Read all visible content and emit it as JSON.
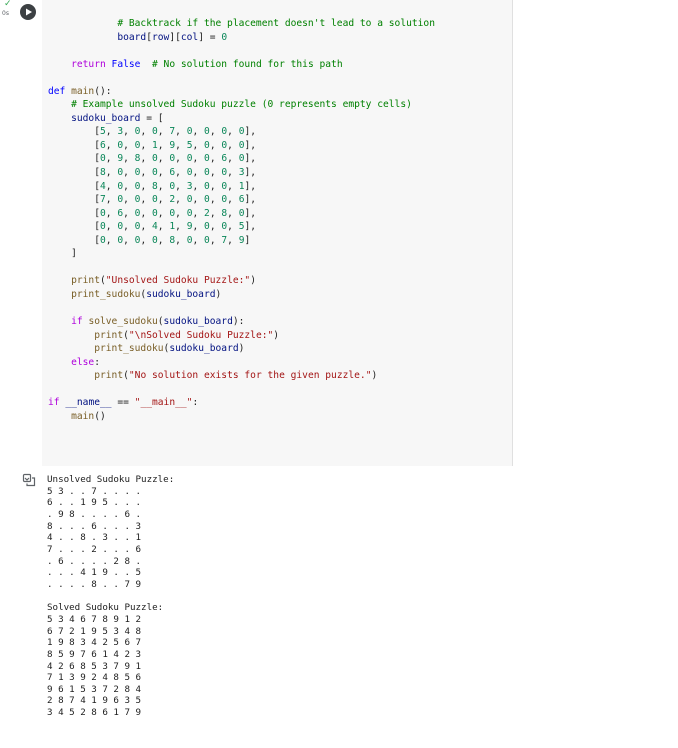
{
  "cell": {
    "status_check": "✓",
    "exec_time": "0s",
    "run_button_label": "Run cell"
  },
  "code_lines": [
    {
      "segments": [
        {
          "t": "            ",
          "c": "ink"
        },
        {
          "t": "# Backtrack if the placement doesn't lead to a solution",
          "c": "cm"
        }
      ]
    },
    {
      "segments": [
        {
          "t": "            ",
          "c": "ink"
        },
        {
          "t": "board",
          "c": "var"
        },
        {
          "t": "[",
          "c": "ink"
        },
        {
          "t": "row",
          "c": "var"
        },
        {
          "t": "][",
          "c": "ink"
        },
        {
          "t": "col",
          "c": "var"
        },
        {
          "t": "] = ",
          "c": "ink"
        },
        {
          "t": "0",
          "c": "nm"
        }
      ]
    },
    {
      "segments": []
    },
    {
      "segments": [
        {
          "t": "    ",
          "c": "ink"
        },
        {
          "t": "return",
          "c": "kw2"
        },
        {
          "t": " ",
          "c": "ink"
        },
        {
          "t": "False",
          "c": "fal"
        },
        {
          "t": "  ",
          "c": "ink"
        },
        {
          "t": "# No solution found for this path",
          "c": "cm"
        }
      ]
    },
    {
      "segments": []
    },
    {
      "segments": [
        {
          "t": "def",
          "c": "kw"
        },
        {
          "t": " ",
          "c": "ink"
        },
        {
          "t": "main",
          "c": "fn"
        },
        {
          "t": "():",
          "c": "ink"
        }
      ]
    },
    {
      "segments": [
        {
          "t": "    ",
          "c": "ink"
        },
        {
          "t": "# Example unsolved Sudoku puzzle (0 represents empty cells)",
          "c": "cm"
        }
      ]
    },
    {
      "segments": [
        {
          "t": "    ",
          "c": "ink"
        },
        {
          "t": "sudoku_board",
          "c": "var"
        },
        {
          "t": " = [",
          "c": "ink"
        }
      ]
    },
    {
      "segments": [
        {
          "t": "        [",
          "c": "ink"
        },
        {
          "t": "5",
          "c": "nm"
        },
        {
          "t": ", ",
          "c": "ink"
        },
        {
          "t": "3",
          "c": "nm"
        },
        {
          "t": ", ",
          "c": "ink"
        },
        {
          "t": "0",
          "c": "nm"
        },
        {
          "t": ", ",
          "c": "ink"
        },
        {
          "t": "0",
          "c": "nm"
        },
        {
          "t": ", ",
          "c": "ink"
        },
        {
          "t": "7",
          "c": "nm"
        },
        {
          "t": ", ",
          "c": "ink"
        },
        {
          "t": "0",
          "c": "nm"
        },
        {
          "t": ", ",
          "c": "ink"
        },
        {
          "t": "0",
          "c": "nm"
        },
        {
          "t": ", ",
          "c": "ink"
        },
        {
          "t": "0",
          "c": "nm"
        },
        {
          "t": ", ",
          "c": "ink"
        },
        {
          "t": "0",
          "c": "nm"
        },
        {
          "t": "],",
          "c": "ink"
        }
      ]
    },
    {
      "segments": [
        {
          "t": "        [",
          "c": "ink"
        },
        {
          "t": "6",
          "c": "nm"
        },
        {
          "t": ", ",
          "c": "ink"
        },
        {
          "t": "0",
          "c": "nm"
        },
        {
          "t": ", ",
          "c": "ink"
        },
        {
          "t": "0",
          "c": "nm"
        },
        {
          "t": ", ",
          "c": "ink"
        },
        {
          "t": "1",
          "c": "nm"
        },
        {
          "t": ", ",
          "c": "ink"
        },
        {
          "t": "9",
          "c": "nm"
        },
        {
          "t": ", ",
          "c": "ink"
        },
        {
          "t": "5",
          "c": "nm"
        },
        {
          "t": ", ",
          "c": "ink"
        },
        {
          "t": "0",
          "c": "nm"
        },
        {
          "t": ", ",
          "c": "ink"
        },
        {
          "t": "0",
          "c": "nm"
        },
        {
          "t": ", ",
          "c": "ink"
        },
        {
          "t": "0",
          "c": "nm"
        },
        {
          "t": "],",
          "c": "ink"
        }
      ]
    },
    {
      "segments": [
        {
          "t": "        [",
          "c": "ink"
        },
        {
          "t": "0",
          "c": "nm"
        },
        {
          "t": ", ",
          "c": "ink"
        },
        {
          "t": "9",
          "c": "nm"
        },
        {
          "t": ", ",
          "c": "ink"
        },
        {
          "t": "8",
          "c": "nm"
        },
        {
          "t": ", ",
          "c": "ink"
        },
        {
          "t": "0",
          "c": "nm"
        },
        {
          "t": ", ",
          "c": "ink"
        },
        {
          "t": "0",
          "c": "nm"
        },
        {
          "t": ", ",
          "c": "ink"
        },
        {
          "t": "0",
          "c": "nm"
        },
        {
          "t": ", ",
          "c": "ink"
        },
        {
          "t": "0",
          "c": "nm"
        },
        {
          "t": ", ",
          "c": "ink"
        },
        {
          "t": "6",
          "c": "nm"
        },
        {
          "t": ", ",
          "c": "ink"
        },
        {
          "t": "0",
          "c": "nm"
        },
        {
          "t": "],",
          "c": "ink"
        }
      ]
    },
    {
      "segments": [
        {
          "t": "        [",
          "c": "ink"
        },
        {
          "t": "8",
          "c": "nm"
        },
        {
          "t": ", ",
          "c": "ink"
        },
        {
          "t": "0",
          "c": "nm"
        },
        {
          "t": ", ",
          "c": "ink"
        },
        {
          "t": "0",
          "c": "nm"
        },
        {
          "t": ", ",
          "c": "ink"
        },
        {
          "t": "0",
          "c": "nm"
        },
        {
          "t": ", ",
          "c": "ink"
        },
        {
          "t": "6",
          "c": "nm"
        },
        {
          "t": ", ",
          "c": "ink"
        },
        {
          "t": "0",
          "c": "nm"
        },
        {
          "t": ", ",
          "c": "ink"
        },
        {
          "t": "0",
          "c": "nm"
        },
        {
          "t": ", ",
          "c": "ink"
        },
        {
          "t": "0",
          "c": "nm"
        },
        {
          "t": ", ",
          "c": "ink"
        },
        {
          "t": "3",
          "c": "nm"
        },
        {
          "t": "],",
          "c": "ink"
        }
      ]
    },
    {
      "segments": [
        {
          "t": "        [",
          "c": "ink"
        },
        {
          "t": "4",
          "c": "nm"
        },
        {
          "t": ", ",
          "c": "ink"
        },
        {
          "t": "0",
          "c": "nm"
        },
        {
          "t": ", ",
          "c": "ink"
        },
        {
          "t": "0",
          "c": "nm"
        },
        {
          "t": ", ",
          "c": "ink"
        },
        {
          "t": "8",
          "c": "nm"
        },
        {
          "t": ", ",
          "c": "ink"
        },
        {
          "t": "0",
          "c": "nm"
        },
        {
          "t": ", ",
          "c": "ink"
        },
        {
          "t": "3",
          "c": "nm"
        },
        {
          "t": ", ",
          "c": "ink"
        },
        {
          "t": "0",
          "c": "nm"
        },
        {
          "t": ", ",
          "c": "ink"
        },
        {
          "t": "0",
          "c": "nm"
        },
        {
          "t": ", ",
          "c": "ink"
        },
        {
          "t": "1",
          "c": "nm"
        },
        {
          "t": "],",
          "c": "ink"
        }
      ]
    },
    {
      "segments": [
        {
          "t": "        [",
          "c": "ink"
        },
        {
          "t": "7",
          "c": "nm"
        },
        {
          "t": ", ",
          "c": "ink"
        },
        {
          "t": "0",
          "c": "nm"
        },
        {
          "t": ", ",
          "c": "ink"
        },
        {
          "t": "0",
          "c": "nm"
        },
        {
          "t": ", ",
          "c": "ink"
        },
        {
          "t": "0",
          "c": "nm"
        },
        {
          "t": ", ",
          "c": "ink"
        },
        {
          "t": "2",
          "c": "nm"
        },
        {
          "t": ", ",
          "c": "ink"
        },
        {
          "t": "0",
          "c": "nm"
        },
        {
          "t": ", ",
          "c": "ink"
        },
        {
          "t": "0",
          "c": "nm"
        },
        {
          "t": ", ",
          "c": "ink"
        },
        {
          "t": "0",
          "c": "nm"
        },
        {
          "t": ", ",
          "c": "ink"
        },
        {
          "t": "6",
          "c": "nm"
        },
        {
          "t": "],",
          "c": "ink"
        }
      ]
    },
    {
      "segments": [
        {
          "t": "        [",
          "c": "ink"
        },
        {
          "t": "0",
          "c": "nm"
        },
        {
          "t": ", ",
          "c": "ink"
        },
        {
          "t": "6",
          "c": "nm"
        },
        {
          "t": ", ",
          "c": "ink"
        },
        {
          "t": "0",
          "c": "nm"
        },
        {
          "t": ", ",
          "c": "ink"
        },
        {
          "t": "0",
          "c": "nm"
        },
        {
          "t": ", ",
          "c": "ink"
        },
        {
          "t": "0",
          "c": "nm"
        },
        {
          "t": ", ",
          "c": "ink"
        },
        {
          "t": "0",
          "c": "nm"
        },
        {
          "t": ", ",
          "c": "ink"
        },
        {
          "t": "2",
          "c": "nm"
        },
        {
          "t": ", ",
          "c": "ink"
        },
        {
          "t": "8",
          "c": "nm"
        },
        {
          "t": ", ",
          "c": "ink"
        },
        {
          "t": "0",
          "c": "nm"
        },
        {
          "t": "],",
          "c": "ink"
        }
      ]
    },
    {
      "segments": [
        {
          "t": "        [",
          "c": "ink"
        },
        {
          "t": "0",
          "c": "nm"
        },
        {
          "t": ", ",
          "c": "ink"
        },
        {
          "t": "0",
          "c": "nm"
        },
        {
          "t": ", ",
          "c": "ink"
        },
        {
          "t": "0",
          "c": "nm"
        },
        {
          "t": ", ",
          "c": "ink"
        },
        {
          "t": "4",
          "c": "nm"
        },
        {
          "t": ", ",
          "c": "ink"
        },
        {
          "t": "1",
          "c": "nm"
        },
        {
          "t": ", ",
          "c": "ink"
        },
        {
          "t": "9",
          "c": "nm"
        },
        {
          "t": ", ",
          "c": "ink"
        },
        {
          "t": "0",
          "c": "nm"
        },
        {
          "t": ", ",
          "c": "ink"
        },
        {
          "t": "0",
          "c": "nm"
        },
        {
          "t": ", ",
          "c": "ink"
        },
        {
          "t": "5",
          "c": "nm"
        },
        {
          "t": "],",
          "c": "ink"
        }
      ]
    },
    {
      "segments": [
        {
          "t": "        [",
          "c": "ink"
        },
        {
          "t": "0",
          "c": "nm"
        },
        {
          "t": ", ",
          "c": "ink"
        },
        {
          "t": "0",
          "c": "nm"
        },
        {
          "t": ", ",
          "c": "ink"
        },
        {
          "t": "0",
          "c": "nm"
        },
        {
          "t": ", ",
          "c": "ink"
        },
        {
          "t": "0",
          "c": "nm"
        },
        {
          "t": ", ",
          "c": "ink"
        },
        {
          "t": "8",
          "c": "nm"
        },
        {
          "t": ", ",
          "c": "ink"
        },
        {
          "t": "0",
          "c": "nm"
        },
        {
          "t": ", ",
          "c": "ink"
        },
        {
          "t": "0",
          "c": "nm"
        },
        {
          "t": ", ",
          "c": "ink"
        },
        {
          "t": "7",
          "c": "nm"
        },
        {
          "t": ", ",
          "c": "ink"
        },
        {
          "t": "9",
          "c": "nm"
        },
        {
          "t": "]",
          "c": "ink"
        }
      ]
    },
    {
      "segments": [
        {
          "t": "    ]",
          "c": "ink"
        }
      ]
    },
    {
      "segments": []
    },
    {
      "segments": [
        {
          "t": "    ",
          "c": "ink"
        },
        {
          "t": "print",
          "c": "bi"
        },
        {
          "t": "(",
          "c": "ink"
        },
        {
          "t": "\"Unsolved Sudoku Puzzle:\"",
          "c": "st"
        },
        {
          "t": ")",
          "c": "ink"
        }
      ]
    },
    {
      "segments": [
        {
          "t": "    ",
          "c": "ink"
        },
        {
          "t": "print_sudoku",
          "c": "fn"
        },
        {
          "t": "(",
          "c": "ink"
        },
        {
          "t": "sudoku_board",
          "c": "var"
        },
        {
          "t": ")",
          "c": "ink"
        }
      ]
    },
    {
      "segments": []
    },
    {
      "segments": [
        {
          "t": "    ",
          "c": "ink"
        },
        {
          "t": "if",
          "c": "kw2"
        },
        {
          "t": " ",
          "c": "ink"
        },
        {
          "t": "solve_sudoku",
          "c": "fn"
        },
        {
          "t": "(",
          "c": "ink"
        },
        {
          "t": "sudoku_board",
          "c": "var"
        },
        {
          "t": "):",
          "c": "ink"
        }
      ]
    },
    {
      "segments": [
        {
          "t": "        ",
          "c": "ink"
        },
        {
          "t": "print",
          "c": "bi"
        },
        {
          "t": "(",
          "c": "ink"
        },
        {
          "t": "\"\\nSolved Sudoku Puzzle:\"",
          "c": "st"
        },
        {
          "t": ")",
          "c": "ink"
        }
      ]
    },
    {
      "segments": [
        {
          "t": "        ",
          "c": "ink"
        },
        {
          "t": "print_sudoku",
          "c": "fn"
        },
        {
          "t": "(",
          "c": "ink"
        },
        {
          "t": "sudoku_board",
          "c": "var"
        },
        {
          "t": ")",
          "c": "ink"
        }
      ]
    },
    {
      "segments": [
        {
          "t": "    ",
          "c": "ink"
        },
        {
          "t": "else",
          "c": "kw2"
        },
        {
          "t": ":",
          "c": "ink"
        }
      ]
    },
    {
      "segments": [
        {
          "t": "        ",
          "c": "ink"
        },
        {
          "t": "print",
          "c": "bi"
        },
        {
          "t": "(",
          "c": "ink"
        },
        {
          "t": "\"No solution exists for the given puzzle.\"",
          "c": "st"
        },
        {
          "t": ")",
          "c": "ink"
        }
      ]
    },
    {
      "segments": []
    },
    {
      "segments": [
        {
          "t": "if",
          "c": "kw2"
        },
        {
          "t": " ",
          "c": "ink"
        },
        {
          "t": "__name__",
          "c": "var"
        },
        {
          "t": " == ",
          "c": "ink"
        },
        {
          "t": "\"__main__\"",
          "c": "st"
        },
        {
          "t": ":",
          "c": "ink"
        }
      ]
    },
    {
      "segments": [
        {
          "t": "    ",
          "c": "ink"
        },
        {
          "t": "main",
          "c": "fn"
        },
        {
          "t": "()",
          "c": "ink"
        }
      ]
    }
  ],
  "output_lines": [
    "Unsolved Sudoku Puzzle:",
    "5 3 . . 7 . . . .",
    "6 . . 1 9 5 . . .",
    ". 9 8 . . . . 6 .",
    "8 . . . 6 . . . 3",
    "4 . . 8 . 3 . . 1",
    "7 . . . 2 . . . 6",
    ". 6 . . . . 2 8 .",
    ". . . 4 1 9 . . 5",
    ". . . . 8 . . 7 9",
    "",
    "Solved Sudoku Puzzle:",
    "5 3 4 6 7 8 9 1 2",
    "6 7 2 1 9 5 3 4 8",
    "1 9 8 3 4 2 5 6 7",
    "8 5 9 7 6 1 4 2 3",
    "4 2 6 8 5 3 7 9 1",
    "7 1 3 9 2 4 8 5 6",
    "9 6 1 5 3 7 2 8 4",
    "2 8 7 4 1 9 6 3 5",
    "3 4 5 2 8 6 1 7 9"
  ]
}
